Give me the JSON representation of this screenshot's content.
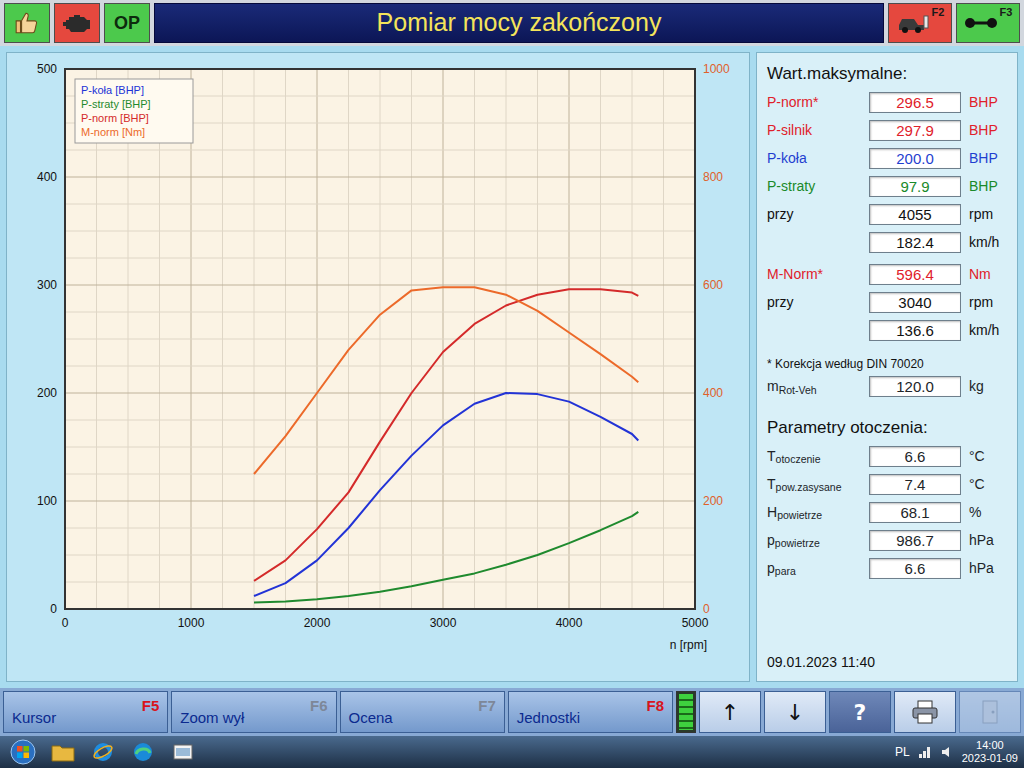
{
  "toolbar": {
    "left": [
      {
        "kind": "thumbs",
        "color": "#4cc94c"
      },
      {
        "kind": "engine",
        "color": "#e5483e"
      },
      {
        "kind": "text",
        "label": "OP",
        "color": "#4cc94c"
      }
    ],
    "title": "Pomiar mocy zakończony",
    "right": [
      {
        "kind": "car",
        "label": "F2",
        "color": "#e5483e"
      },
      {
        "kind": "axle",
        "label": "F3",
        "color": "#4cc94c"
      }
    ]
  },
  "chart": {
    "x_label": "n [rpm]",
    "x_ticks": [
      "0",
      "1000",
      "2000",
      "3000",
      "4000",
      "5000"
    ],
    "y_left_ticks": [
      "0",
      "100",
      "200",
      "300",
      "400",
      "500"
    ],
    "y_right_ticks": [
      "0",
      "200",
      "400",
      "600",
      "800",
      "1000"
    ],
    "rpm": [
      1500,
      1750,
      2000,
      2250,
      2500,
      2750,
      3000,
      3250,
      3500,
      3750,
      4000,
      4250,
      4500,
      4550
    ],
    "series": [
      {
        "label": "P-koła [BHP]",
        "axis": "left",
        "color": "#2233d6",
        "values": [
          12,
          24,
          45,
          75,
          110,
          142,
          170,
          190,
          200,
          199,
          192,
          178,
          162,
          156
        ]
      },
      {
        "label": "P-straty [BHP]",
        "axis": "left",
        "color": "#1f8a2e",
        "values": [
          6,
          7,
          9,
          12,
          16,
          21,
          27,
          33,
          41,
          50,
          61,
          73,
          86,
          90
        ]
      },
      {
        "label": "P-norm [BHP]",
        "axis": "left",
        "color": "#d42a2a",
        "values": [
          26,
          45,
          74,
          108,
          155,
          200,
          238,
          264,
          281,
          291,
          296,
          296,
          293,
          290
        ]
      },
      {
        "label": "M-norm [Nm]",
        "axis": "right",
        "color": "#ec6a2a",
        "values": [
          250,
          320,
          400,
          480,
          545,
          590,
          596,
          596,
          582,
          552,
          512,
          472,
          430,
          420
        ]
      }
    ]
  },
  "max_values": {
    "title": "Wart.maksymalne:",
    "groups": [
      {
        "rows": [
          {
            "label": "P-norm*",
            "value": "296.5",
            "unit": "BHP",
            "color": "#e0202a"
          },
          {
            "label": "P-silnik",
            "value": "297.9",
            "unit": "BHP",
            "color": "#e0202a"
          },
          {
            "label": "P-koła",
            "value": "200.0",
            "unit": "BHP",
            "color": "#1f3fd0"
          },
          {
            "label": "P-straty",
            "value": "97.9",
            "unit": "BHP",
            "color": "#1a8a2a"
          },
          {
            "label": "przy",
            "value": "4055",
            "unit": "rpm",
            "color": "#111111"
          },
          {
            "label": "",
            "value": "182.4",
            "unit": "km/h",
            "color": "#111111"
          }
        ]
      },
      {
        "rows": [
          {
            "label": "M-Norm*",
            "value": "596.4",
            "unit": "Nm",
            "color": "#e0202a"
          },
          {
            "label": "przy",
            "value": "3040",
            "unit": "rpm",
            "color": "#111111"
          },
          {
            "label": "",
            "value": "136.6",
            "unit": "km/h",
            "color": "#111111"
          }
        ]
      }
    ],
    "note": "* Korekcja według DIN 70020",
    "mass": {
      "label": "m",
      "sub": "Rot-Veh",
      "value": "120.0",
      "unit": "kg"
    }
  },
  "ambient": {
    "title": "Parametry otoczenia:",
    "rows": [
      {
        "label": "T",
        "sub": "otoczenie",
        "value": "6.6",
        "unit": "°C"
      },
      {
        "label": "T",
        "sub": "pow.zasysane",
        "value": "7.4",
        "unit": "°C"
      },
      {
        "label": "H",
        "sub": "powietrze",
        "value": "68.1",
        "unit": "%"
      },
      {
        "label": "p",
        "sub": "powietrze",
        "value": "986.7",
        "unit": "hPa"
      },
      {
        "label": "p",
        "sub": "para",
        "value": "6.6",
        "unit": "hPa"
      }
    ]
  },
  "timestamp": "09.01.2023 11:40",
  "function_keys": [
    {
      "label": "Kursor",
      "key": "F5",
      "key_active": true
    },
    {
      "label": "Zoom wył",
      "key": "F6",
      "key_active": false
    },
    {
      "label": "Ocena",
      "key": "F7",
      "key_active": false
    },
    {
      "label": "Jednostki",
      "key": "F8",
      "key_active": true
    }
  ],
  "meter": {
    "level": 1
  },
  "nav_buttons": [
    {
      "kind": "text",
      "label": "↑",
      "disabled": false
    },
    {
      "kind": "text",
      "label": "↓",
      "disabled": false
    },
    {
      "kind": "help",
      "label": "?",
      "disabled": false
    },
    {
      "kind": "printer",
      "disabled": false
    },
    {
      "kind": "exit",
      "disabled": true
    }
  ],
  "taskbar": {
    "apps": [
      {
        "kind": "explorer"
      },
      {
        "kind": "ie"
      },
      {
        "kind": "edge"
      },
      {
        "kind": "viewer"
      }
    ],
    "language": "PL",
    "time": "14:00",
    "date": "2023-01-09"
  }
}
